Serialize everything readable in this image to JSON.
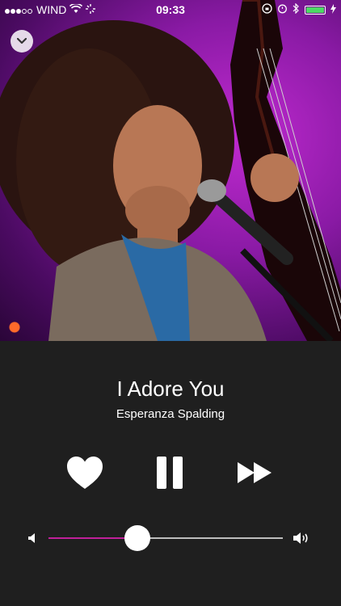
{
  "status_bar": {
    "carrier": "WIND",
    "time": "09:33",
    "signal_bars_filled": 3,
    "signal_bars_total": 5,
    "battery_level": 1.0,
    "battery_color": "#4cd964"
  },
  "artwork": {
    "colors": {
      "bg": "#8a1aa5"
    }
  },
  "track": {
    "title": "I Adore You",
    "artist": "Esperanza Spalding"
  },
  "controls": {
    "like_icon": "heart-icon",
    "play_pause_icon": "pause-icon",
    "next_icon": "fast-forward-icon",
    "collapse_icon": "chevron-down-icon"
  },
  "volume": {
    "level": 0.38,
    "fill_color": "#c0209a",
    "min_icon": "speaker-low-icon",
    "max_icon": "speaker-high-icon"
  }
}
